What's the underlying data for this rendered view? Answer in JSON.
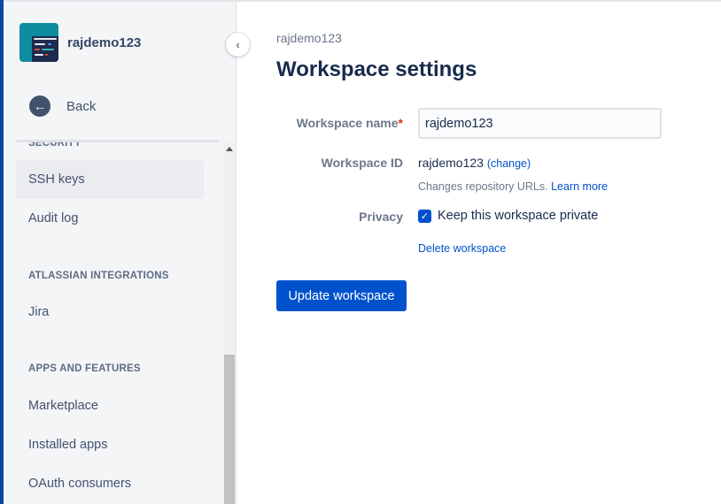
{
  "sidebar": {
    "workspace_name": "rajdemo123",
    "back_label": "Back",
    "sections": [
      {
        "title": "SECURITY",
        "items": [
          "SSH keys",
          "Audit log"
        ]
      },
      {
        "title": "ATLASSIAN INTEGRATIONS",
        "items": [
          "Jira"
        ]
      },
      {
        "title": "APPS AND FEATURES",
        "items": [
          "Marketplace",
          "Installed apps",
          "OAuth consumers"
        ]
      }
    ],
    "active_item": "SSH keys"
  },
  "main": {
    "breadcrumb": "rajdemo123",
    "title": "Workspace settings",
    "name_label": "Workspace name",
    "required_mark": "*",
    "name_value": "rajdemo123",
    "id_label": "Workspace ID",
    "id_value": "rajdemo123",
    "change_link": "(change)",
    "help_text": "Changes repository URLs.",
    "learn_more": "Learn more",
    "privacy_label": "Privacy",
    "private_checkbox_label": "Keep this workspace private",
    "private_checked": true,
    "delete_link": "Delete workspace",
    "update_button": "Update workspace"
  },
  "colors": {
    "accent": "#0052cc",
    "sidebar_bg": "#f4f5f7",
    "left_bar": "#0747a6"
  }
}
